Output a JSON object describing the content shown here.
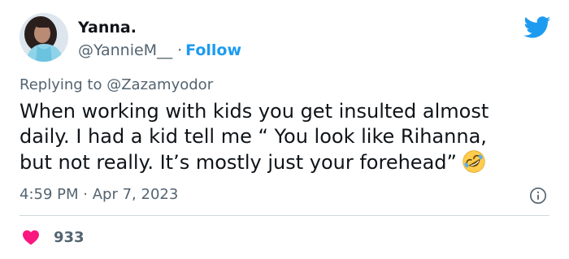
{
  "user": {
    "display_name": "Yanna.",
    "handle": "@YannieM__",
    "separator": "·",
    "follow_label": "Follow"
  },
  "reply": {
    "prefix": "Replying to",
    "to_handle": "@Zazamyodor"
  },
  "tweet": {
    "lines": [
      "When working with kids you get insulted almost",
      "daily. I had a kid tell me “ You look like Rihanna,",
      "but not really. It’s mostly just your forehead”"
    ],
    "emoji": "rolling-on-floor-laughing-emoji"
  },
  "meta": {
    "time": "4:59 PM",
    "separator": "·",
    "date": "Apr 7, 2023"
  },
  "engagement": {
    "like_count": "933"
  },
  "colors": {
    "accent": "#1d9bf0",
    "like": "#f91880",
    "muted": "#536471",
    "text": "#0f1419"
  },
  "icons": [
    "twitter-bird-icon",
    "info-icon",
    "heart-icon"
  ]
}
